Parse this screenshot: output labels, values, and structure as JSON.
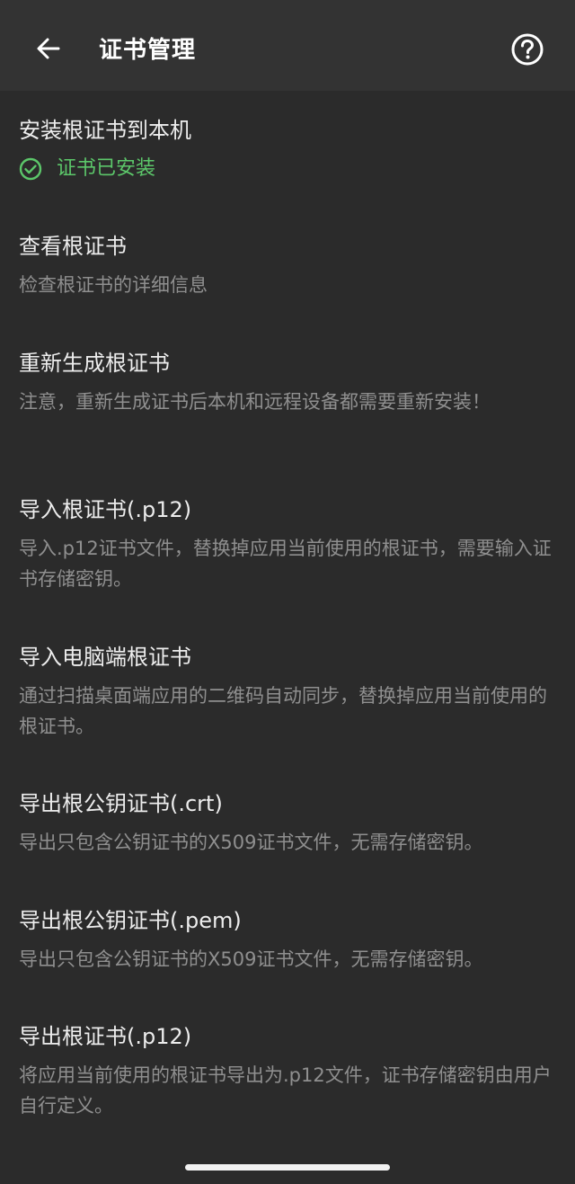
{
  "header": {
    "title": "证书管理",
    "back_icon": "arrow-left-icon",
    "help_icon": "help-circle-icon"
  },
  "items": [
    {
      "title": "安装根证书到本机",
      "status": "证书已安装",
      "status_icon": "check-circle-icon",
      "status_color": "#5cc76a"
    },
    {
      "title": "查看根证书",
      "desc": "检查根证书的详细信息"
    },
    {
      "title": "重新生成根证书",
      "desc": "注意，重新生成证书后本机和远程设备都需要重新安装！"
    },
    {
      "title": "导入根证书(.p12)",
      "desc": "导入.p12证书文件，替换掉应用当前使用的根证书，需要输入证书存储密钥。"
    },
    {
      "title": "导入电脑端根证书",
      "desc": "通过扫描桌面端应用的二维码自动同步，替换掉应用当前使用的根证书。"
    },
    {
      "title": "导出根公钥证书(.crt)",
      "desc": "导出只包含公钥证书的X509证书文件，无需存储密钥。"
    },
    {
      "title": "导出根公钥证书(.pem)",
      "desc": "导出只包含公钥证书的X509证书文件，无需存储密钥。"
    },
    {
      "title": "导出根证书(.p12)",
      "desc": "将应用当前使用的根证书导出为.p12文件，证书存储密钥由用户自行定义。"
    }
  ]
}
